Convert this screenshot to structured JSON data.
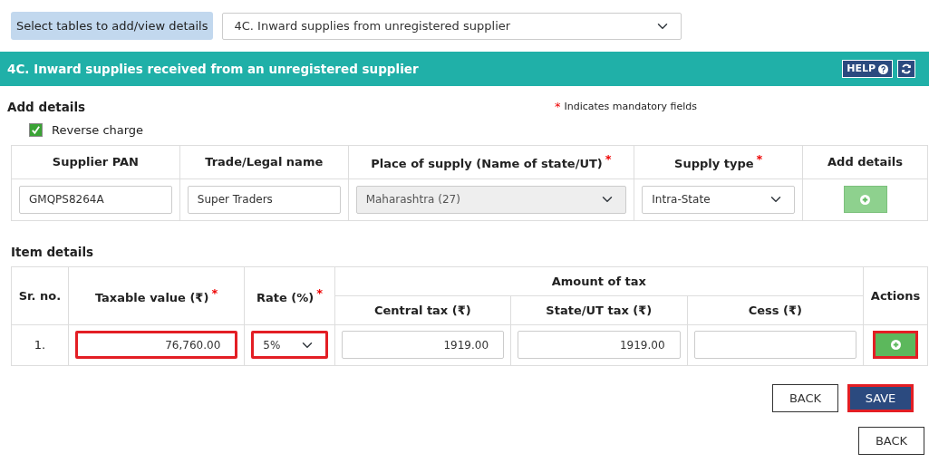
{
  "table_selector": {
    "label": "Select tables to add/view details",
    "value": "4C. Inward supplies from unregistered supplier"
  },
  "section": {
    "title": "4C. Inward supplies received from an unregistered supplier",
    "help_button": "HELP"
  },
  "add_details": {
    "heading": "Add details",
    "mandatory_mark": "*",
    "mandatory_note": "Indicates mandatory fields",
    "reverse_charge": {
      "label": "Reverse charge",
      "checked": true
    },
    "columns": [
      {
        "label": "Supplier PAN"
      },
      {
        "label": "Trade/Legal name"
      },
      {
        "label": "Place of supply (Name of state/UT)",
        "mark": "*"
      },
      {
        "label": "Supply type",
        "mark": "*"
      },
      {
        "label": "Add details"
      }
    ],
    "row": {
      "supplier_pan": "GMQPS8264A",
      "trade_name": "Super Traders",
      "place_of_supply": {
        "value": "Maharashtra (27)",
        "disabled": true
      },
      "supply_type": "Intra-State",
      "add_disabled": true
    }
  },
  "item_details": {
    "heading": "Item details",
    "columns": {
      "sr": {
        "label": "Sr. no."
      },
      "taxable": {
        "label": "Taxable value (₹)",
        "mark": "*"
      },
      "rate": {
        "label": "Rate (%)",
        "mark": "*"
      },
      "tax_group": {
        "label": "Amount of tax"
      },
      "central": {
        "label": "Central tax (₹)"
      },
      "state": {
        "label": "State/UT tax (₹)"
      },
      "cess": {
        "label": "Cess (₹)"
      },
      "actions": {
        "label": "Actions"
      }
    },
    "rows": [
      {
        "sr": "1.",
        "taxable": {
          "value": "76,760.00",
          "highlighted": true
        },
        "rate": {
          "value": "5%",
          "highlighted": true
        },
        "central": {
          "value": "1919.00",
          "highlighted": false
        },
        "state": {
          "value": "1919.00",
          "highlighted": false
        },
        "cess": {
          "highlighted": false
        },
        "action_highlighted": true
      }
    ]
  },
  "buttons": [
    {
      "label": "BACK",
      "kind": "outline",
      "highlighted": false
    },
    {
      "label": "SAVE",
      "kind": "primary",
      "highlighted": true
    }
  ],
  "footer_button": {
    "label": "BACK"
  }
}
